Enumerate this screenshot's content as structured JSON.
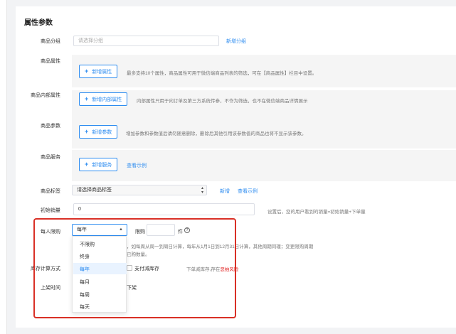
{
  "section_title": "属性参数",
  "group": {
    "label": "商品分组",
    "placeholder": "请选择分组",
    "link": "新增分组"
  },
  "attr": {
    "label": "商品属性",
    "button": "新增属性",
    "hint": "最多支持10个属性，商品属性可用于微信端商品列表的筛选，可在【商品属性】栏目中设置。"
  },
  "inner_attr": {
    "label": "商品内部属性",
    "button": "新增内部属性",
    "hint": "内部属性只用于向订单及第三方系统传参，不作为筛选，也不在微信端商品详情展示"
  },
  "param": {
    "label": "商品参数",
    "button": "新增参数",
    "hint": "增加参数和参数值后请勿随意删除，删除后其他引用该参数值的商品也将不显示该参数。"
  },
  "service": {
    "label": "商品服务",
    "button": "新增服务",
    "link": "查看示例"
  },
  "tag": {
    "label": "商品标签",
    "placeholder": "请选择商品标签",
    "link_add": "新增",
    "link_example": "查看示例"
  },
  "sales": {
    "label": "初始销量",
    "value": "0",
    "hint": "设置后，您的用户看到的销量=初始销量+下单量"
  },
  "limit": {
    "label": "每人限购",
    "selected": "每年",
    "limit_label": "限购",
    "unit": "件",
    "info_icon": "?",
    "hint_line1": "，如每周从周一到周日计算，每年从1月1日到12月31日计算，其他周期同理；变更限购周期",
    "hint_line2": "已购数量。"
  },
  "dropdown": {
    "options": [
      "不限购",
      "终身",
      "每年",
      "每月",
      "每周",
      "每天"
    ],
    "selected_index": 2
  },
  "stock": {
    "label": "库存计算方式",
    "option": "支付减库存",
    "hint_prefix": "下单减库存,存在",
    "hint_risk": "恶拍风险"
  },
  "shelf": {
    "label": "上架时间",
    "text": "下架"
  },
  "colors": {
    "accent": "#2d8cf0",
    "highlight_border": "#d93026",
    "risk": "#e02020"
  }
}
